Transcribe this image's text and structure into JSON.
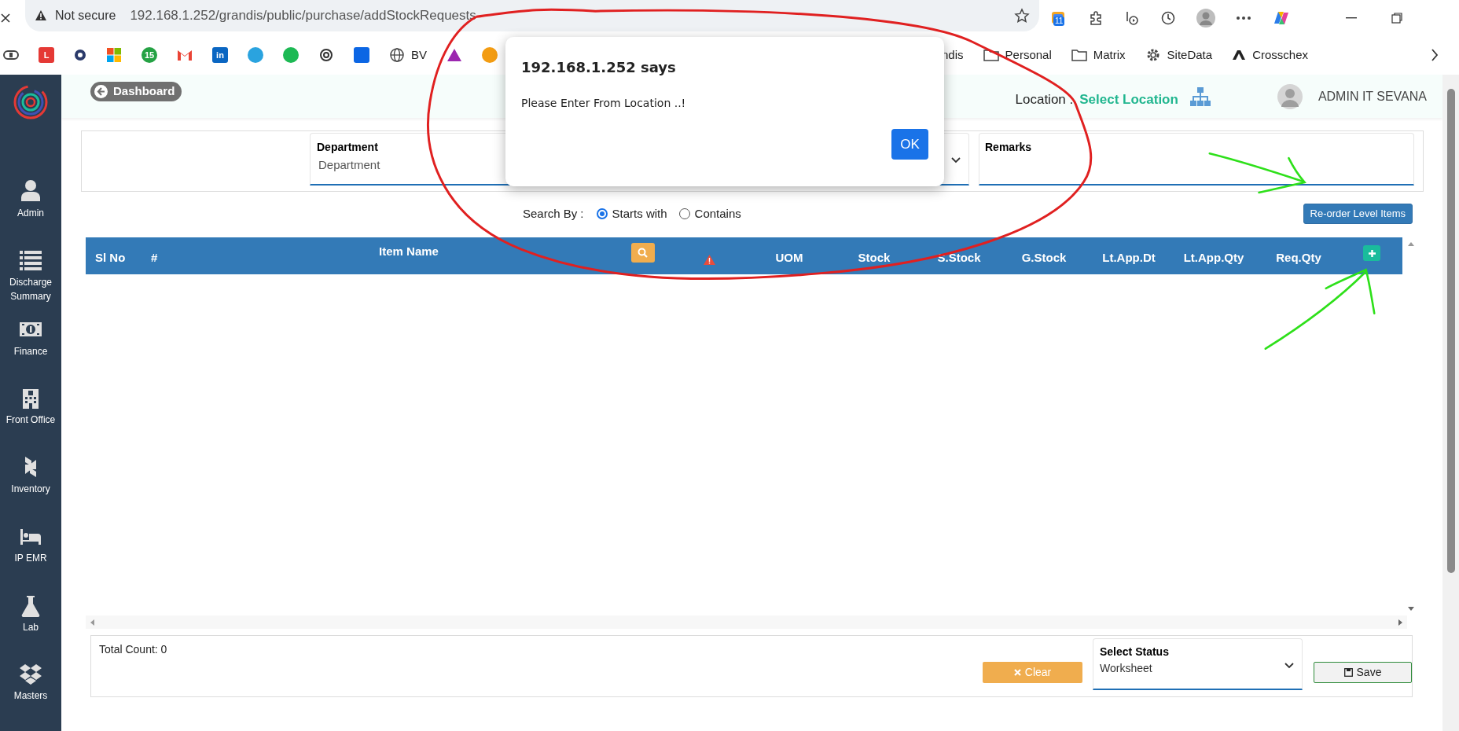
{
  "browser": {
    "security": "Not secure",
    "url": "192.168.1.252/grandis/public/purchase/addStockRequests",
    "extension_badge": "11"
  },
  "bookmarks": [
    {
      "kind": "pill",
      "color": "#444444"
    },
    {
      "kind": "badge",
      "color": "#e53935",
      "text": "L"
    },
    {
      "kind": "dot",
      "color": "#2a3a6a"
    },
    {
      "kind": "squares"
    },
    {
      "kind": "circle",
      "color": "#25a244",
      "text": "15"
    },
    {
      "kind": "mail",
      "color": "#ea4335"
    },
    {
      "kind": "badge",
      "color": "#0a66c2",
      "text": "in"
    },
    {
      "kind": "circle",
      "color": "#2aa3df"
    },
    {
      "kind": "circle",
      "color": "#1db954"
    },
    {
      "kind": "knot",
      "color": "#333333"
    },
    {
      "kind": "badge",
      "color": "#0c66e4"
    },
    {
      "kind": "globe",
      "label": "BV"
    },
    {
      "kind": "triangle",
      "color": "#9c27b0"
    },
    {
      "kind": "circle",
      "color": "#f39c12"
    },
    {
      "kind": "text",
      "label": "ndis"
    },
    {
      "kind": "folder",
      "label": "Personal"
    },
    {
      "kind": "folder",
      "label": "Matrix"
    },
    {
      "kind": "gear",
      "label": "SiteData"
    },
    {
      "kind": "logo",
      "label": "Crosschex"
    }
  ],
  "sidebar": {
    "items": [
      {
        "kind": "user",
        "label": "Admin"
      },
      {
        "kind": "list",
        "label": "Discharge Summary"
      },
      {
        "kind": "money",
        "label": "Finance"
      },
      {
        "kind": "building",
        "label": "Front Office"
      },
      {
        "kind": "inventory",
        "label": "Inventory"
      },
      {
        "kind": "bed",
        "label": "IP EMR"
      },
      {
        "kind": "flask",
        "label": "Lab"
      },
      {
        "kind": "boxes",
        "label": "Masters"
      }
    ]
  },
  "header": {
    "back_button": "Dashboard",
    "location_label": "Location :",
    "location_value": "Select Location",
    "user": "ADMIN IT SEVANA"
  },
  "form": {
    "department": {
      "label": "Department",
      "placeholder": "Department"
    },
    "remarks": {
      "label": "Remarks"
    }
  },
  "search_by": {
    "label": "Search By :",
    "options": [
      {
        "label": "Starts with",
        "selected": true
      },
      {
        "label": "Contains",
        "selected": false
      }
    ]
  },
  "reorder_button": "Re-order Level Items",
  "table": {
    "columns": [
      {
        "kind": "text",
        "label": "Sl No"
      },
      {
        "kind": "text",
        "label": "#"
      },
      {
        "kind": "title",
        "label": "Item Name"
      },
      {
        "kind": "search"
      },
      {
        "kind": "warning"
      },
      {
        "kind": "text",
        "label": "UOM"
      },
      {
        "kind": "text",
        "label": "Stock"
      },
      {
        "kind": "text",
        "label": "S.Stock"
      },
      {
        "kind": "text",
        "label": "G.Stock"
      },
      {
        "kind": "text",
        "label": "Lt.App.Dt"
      },
      {
        "kind": "text",
        "label": "Lt.App.Qty"
      },
      {
        "kind": "text",
        "label": "Req.Qty"
      },
      {
        "kind": "add"
      }
    ]
  },
  "footer": {
    "total": "Total Count: 0",
    "clear_button": "Clear",
    "status": {
      "label": "Select Status",
      "value": "Worksheet"
    },
    "save_button": "Save"
  },
  "dialog": {
    "title": "192.168.1.252 says",
    "message": "Please Enter From Location ..!",
    "button": "OK"
  }
}
